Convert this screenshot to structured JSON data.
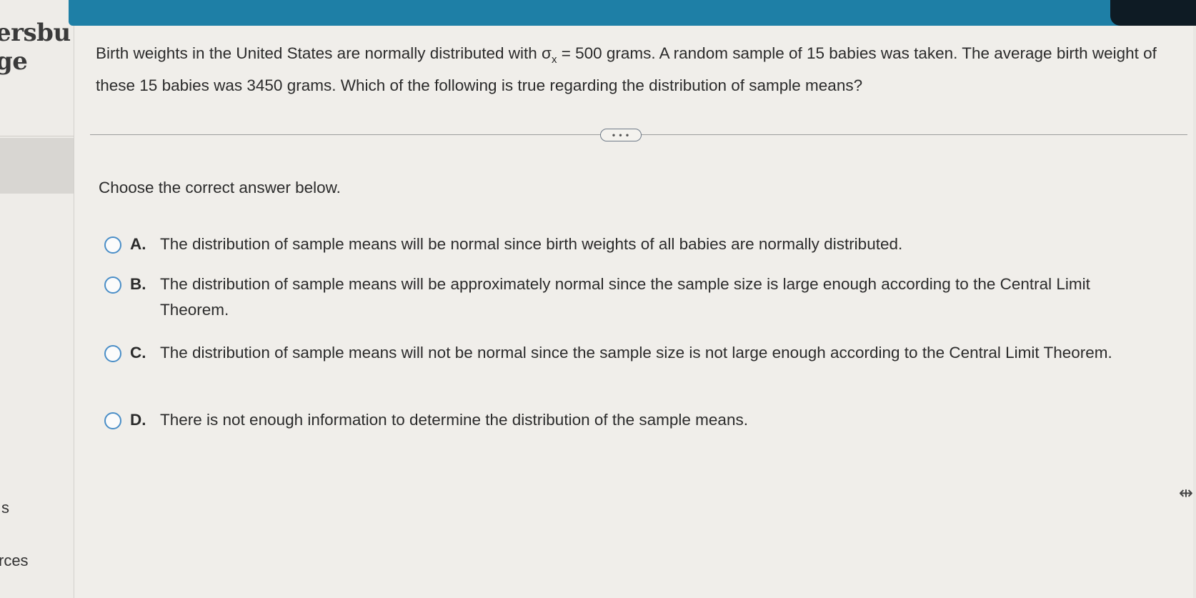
{
  "sidebar": {
    "brand_line1": "ersbu",
    "brand_line2": "ge",
    "item_s": "s",
    "item_rces": "rces"
  },
  "question": {
    "part1": "Birth weights in the United States are normally distributed with σ",
    "subscript": "x",
    "part2": " = 500 grams. A random sample of 15 babies was taken. The average birth weight of these 15 babies was 3450 grams. Which of the following is true regarding the distribution of sample means?"
  },
  "expand_button": "• • •",
  "prompt": "Choose the correct answer below.",
  "options": [
    {
      "letter": "A.",
      "text": "The distribution of sample means will be normal since birth weights of all babies are normally distributed."
    },
    {
      "letter": "B.",
      "text": "The distribution of sample means will be approximately normal since the sample size is large enough according to the Central Limit Theorem."
    },
    {
      "letter": "C.",
      "text": "The distribution of sample means will not be normal since the sample size is not large enough according to the Central Limit Theorem."
    },
    {
      "letter": "D.",
      "text": "There is not enough information to determine the distribution of the sample means."
    }
  ],
  "icons": {
    "resize": "resize-arrow-icon"
  },
  "colors": {
    "topbar": "#1e7fa6",
    "radio": "#4a8ec7",
    "background": "#f0eeea"
  }
}
